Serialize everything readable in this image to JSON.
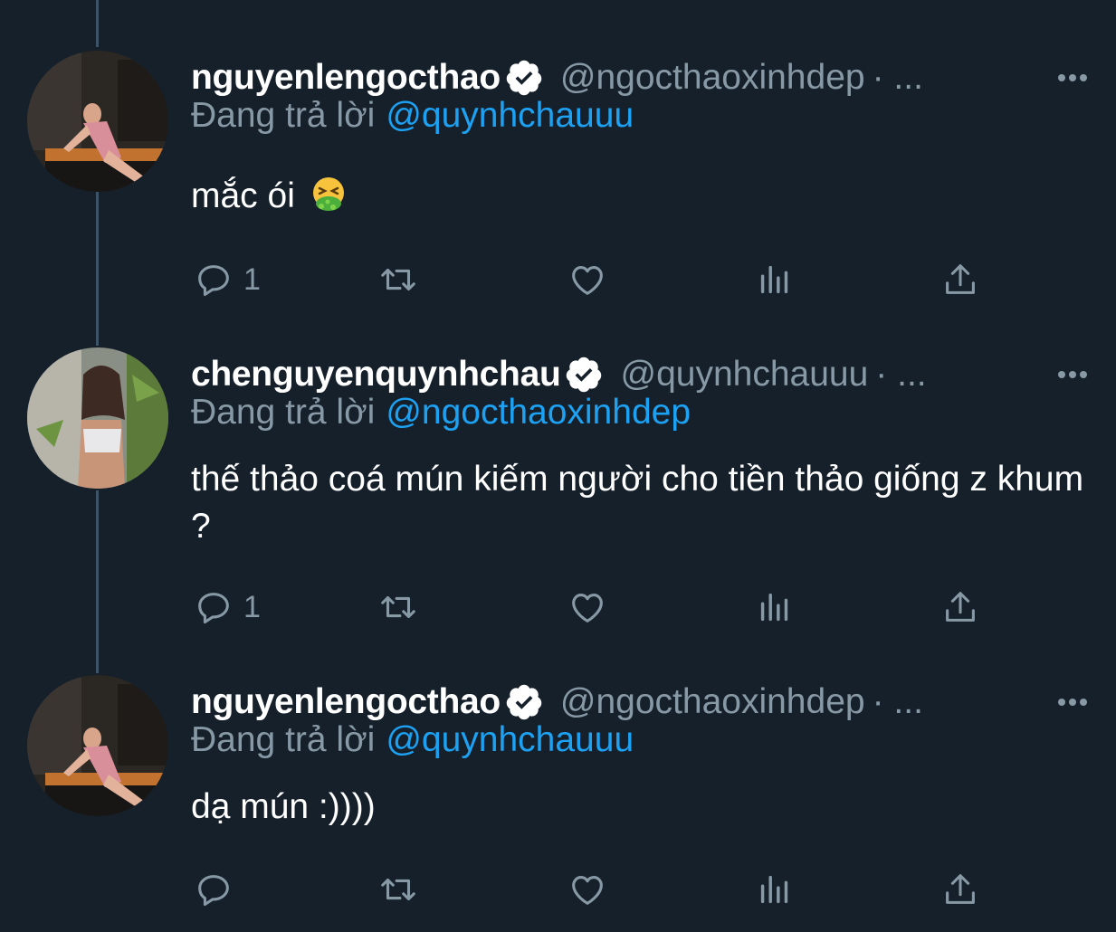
{
  "tweets": [
    {
      "display_name": "nguyenlengocthao",
      "handle": "@ngocthaoxinhdep",
      "separator": "· ...",
      "replying_label": "Đang trả lời",
      "replying_to": "@quynhchauuu",
      "text": "mắc ói",
      "emoji": "nauseated-vomiting-face",
      "reply_count": "1",
      "verified": true
    },
    {
      "display_name": "chenguyenquynhchau",
      "handle": "@quynhchauuu",
      "separator": "· ...",
      "replying_label": "Đang trả lời",
      "replying_to": "@ngocthaoxinhdep",
      "text": "thế thảo coá mún kiếm người cho tiền thảo giống z khum ?",
      "reply_count": "1",
      "verified": true
    },
    {
      "display_name": "nguyenlengocthao",
      "handle": "@ngocthaoxinhdep",
      "separator": "· ...",
      "replying_label": "Đang trả lời",
      "replying_to": "@quynhchauuu",
      "text": "dạ mún :))))",
      "reply_count": "",
      "verified": true
    }
  ],
  "colors": {
    "background": "#15202b",
    "secondary_text": "#8899a6",
    "link": "#1da1f2",
    "thread_line": "#3d5466"
  },
  "icons": [
    "reply-icon",
    "retweet-icon",
    "like-icon",
    "analytics-icon",
    "share-icon",
    "more-icon",
    "verified-badge-icon"
  ]
}
